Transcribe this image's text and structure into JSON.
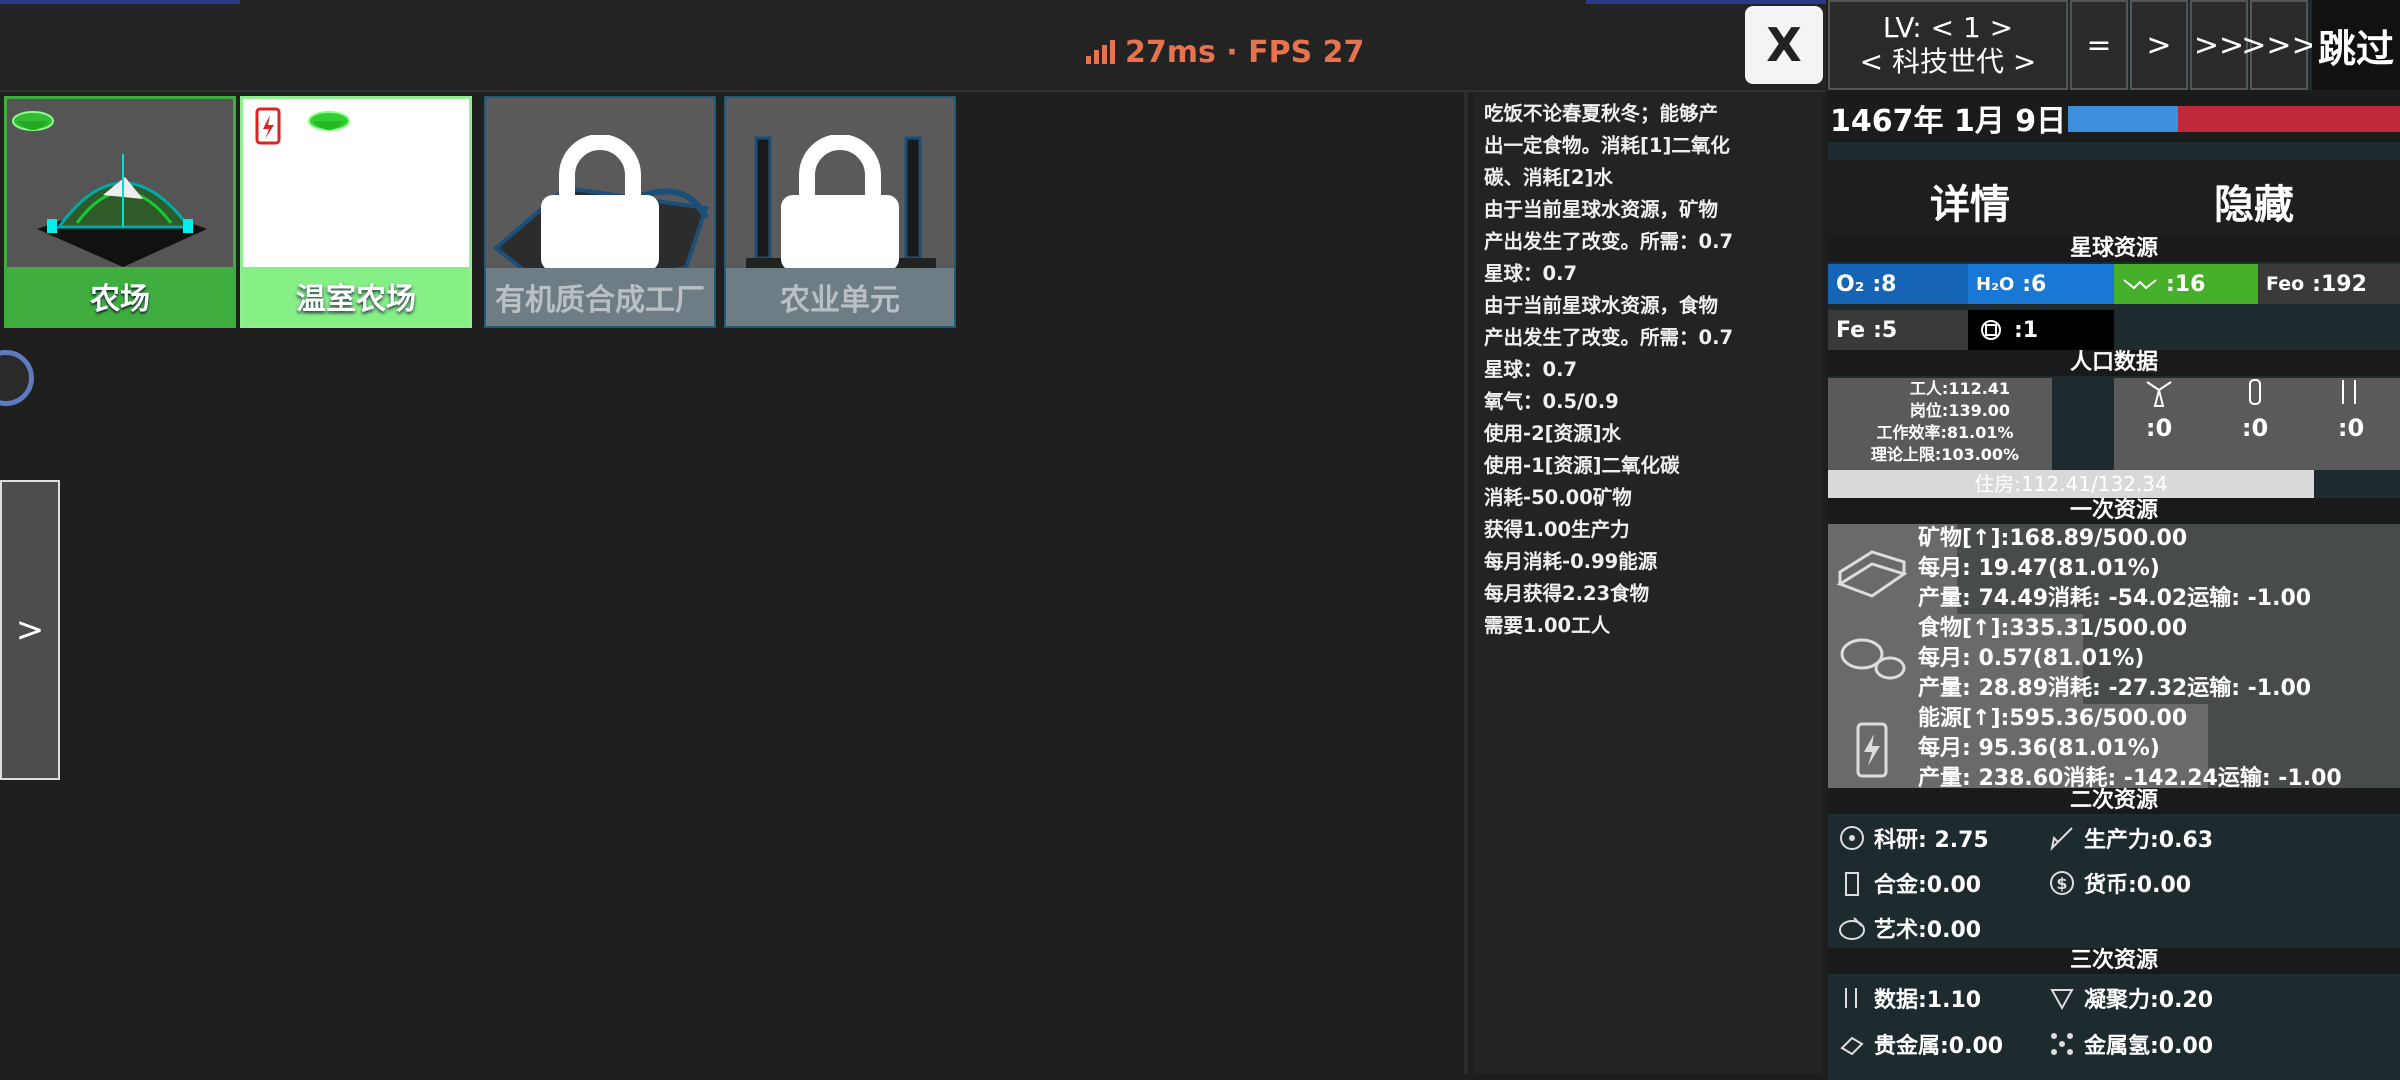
{
  "perf": {
    "text": "27ms · FPS 27"
  },
  "close_label": "X",
  "buildings": [
    {
      "name": "农场",
      "locked": false,
      "selected": true
    },
    {
      "name": "温室农场",
      "locked": false,
      "selected": false
    },
    {
      "name": "有机质合成工厂",
      "locked": true
    },
    {
      "name": "农业单元",
      "locked": true
    }
  ],
  "side_toggle_label": ">",
  "description_lines": [
    "吃饭不论春夏秋冬；能够产",
    "出一定食物。消耗[1]二氧化",
    "碳、消耗[2]水",
    "由于当前星球水资源，矿物",
    "产出发生了改变。所需：0.7",
    "星球：0.7",
    "由于当前星球水资源，食物",
    "产出发生了改变。所需：0.7",
    "星球：0.7",
    "氧气：0.5/0.9",
    "使用-2[资源]水",
    "使用-1[资源]二氧化碳",
    "消耗-50.00矿物",
    "获得1.00生产力",
    "每月消耗-0.99能源",
    "每月获得2.23食物",
    "需要1.00工人"
  ],
  "level": {
    "line1": "LV: < 1 >",
    "line2": "< 科技世代 >"
  },
  "speed_buttons": [
    "=",
    ">",
    ">>",
    ">>>"
  ],
  "skip_label": "跳过",
  "date": "1467年 1月 9日",
  "date_progress": 0.33,
  "tabs": {
    "details": "详情",
    "hide": "隐藏"
  },
  "planet": {
    "title": "星球资源",
    "o2": {
      "symbol": "O₂",
      "value": ":8"
    },
    "h2o": {
      "symbol": "H₂O",
      "value": ":6"
    },
    "bio": {
      "value": ":16"
    },
    "feo": {
      "symbol": "Feo",
      "value": ":192"
    },
    "fe": {
      "symbol": "Fe",
      "value": ":5"
    },
    "chip": {
      "value": ":1"
    }
  },
  "population": {
    "title": "人口数据",
    "workers": "工人:112.41",
    "jobs": "岗位:139.00",
    "efficiency": "工作效率:81.01%",
    "limit": "理论上限:103.00%",
    "col1": ":0",
    "col2": ":0",
    "col3": ":0",
    "housing": "住房:112.41/132.34",
    "housing_fill": 0.85
  },
  "primary": {
    "title": "一次资源",
    "items": [
      {
        "l1": "矿物[↑]:168.89/500.00",
        "l2": "每月:  19.47(81.01%)",
        "l3": "产量:  74.49消耗:  -54.02运输:  -1.00",
        "fill": 0.34
      },
      {
        "l1": "食物[↑]:335.31/500.00",
        "l2": "每月:  0.57(81.01%)",
        "l3": "产量:  28.89消耗:  -27.32运输:  -1.00",
        "fill": 0.67
      },
      {
        "l1": "能源[↑]:595.36/500.00",
        "l2": "每月:  95.36(81.01%)",
        "l3": "产量:  238.60消耗:  -142.24运输:  -1.00",
        "fill": 1.0
      }
    ]
  },
  "secondary": {
    "title": "二次资源",
    "research": "科研:  2.75",
    "productivity": "生产力:0.63",
    "alloy": "合金:0.00",
    "currency": "货币:0.00",
    "art": "艺术:0.00"
  },
  "tertiary": {
    "title": "三次资源",
    "data": "数据:1.10",
    "cohesion": "凝聚力:0.20",
    "precious": "贵金属:0.00",
    "metal_h": "金属氢:0.00"
  }
}
